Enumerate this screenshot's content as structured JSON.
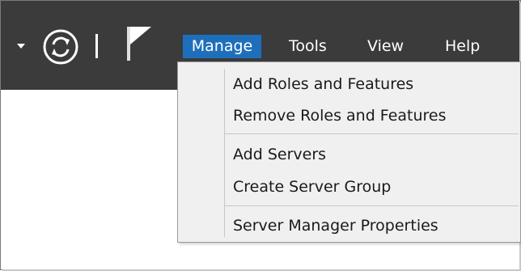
{
  "menubar": {
    "items": [
      {
        "label": "Manage",
        "active": true
      },
      {
        "label": "Tools",
        "active": false
      },
      {
        "label": "View",
        "active": false
      },
      {
        "label": "Help",
        "active": false
      }
    ]
  },
  "toolbar": {
    "icons": [
      "dropdown-arrow-icon",
      "refresh-icon",
      "separator",
      "notifications-flag-icon"
    ]
  },
  "manage_menu": {
    "groups": [
      [
        "Add Roles and Features",
        "Remove Roles and Features"
      ],
      [
        "Add Servers",
        "Create Server Group"
      ],
      [
        "Server Manager Properties"
      ]
    ]
  },
  "colors": {
    "titlebar": "#3b3b3b",
    "accent": "#1e6fbb",
    "menu_bg": "#f0f0f0",
    "menu_text": "#1a1a1a"
  }
}
